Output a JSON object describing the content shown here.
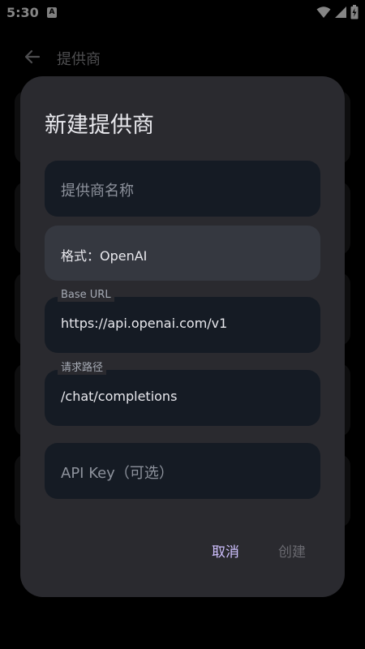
{
  "status_bar": {
    "time": "5:30",
    "app_icon": "A"
  },
  "app_bar": {
    "title": "提供商"
  },
  "dialog": {
    "title": "新建提供商",
    "name_placeholder": "提供商名称",
    "format_value": "格式：OpenAI",
    "base_url": {
      "label": "Base URL",
      "value": "https://api.openai.com/v1"
    },
    "request_path": {
      "label": "请求路径",
      "value": "/chat/completions"
    },
    "api_key_placeholder": "API Key（可选）",
    "cancel_label": "取消",
    "create_label": "创建"
  },
  "colors": {
    "accent": "#cfc0ff",
    "dialog_bg": "#2a2a2f",
    "field_bg": "#151b24"
  }
}
